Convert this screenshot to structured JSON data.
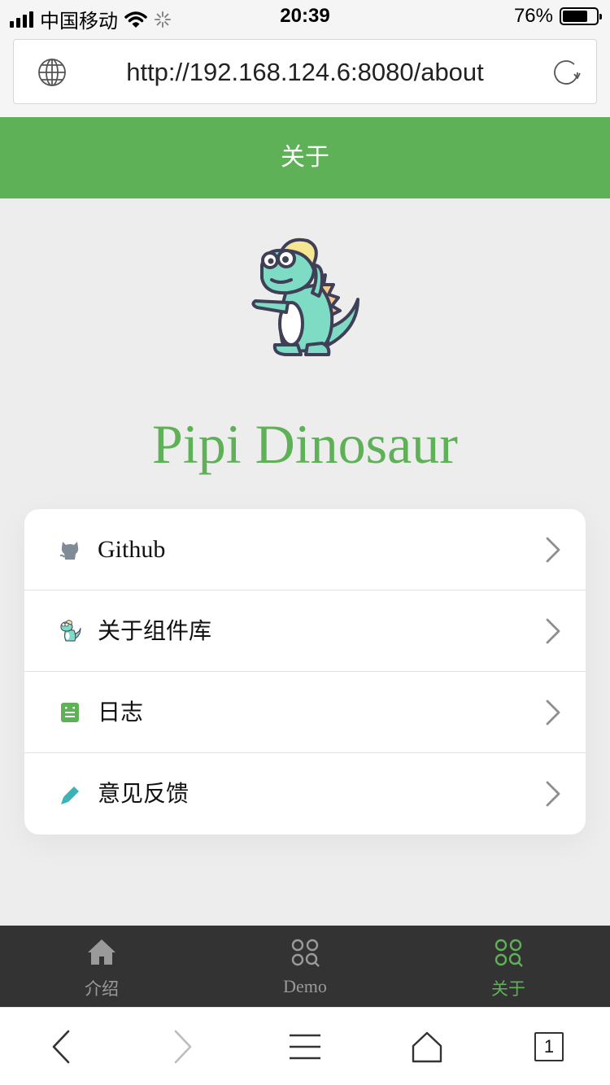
{
  "status_bar": {
    "carrier": "中国移动",
    "time": "20:39",
    "battery_percent_label": "76%",
    "battery_level": 0.76
  },
  "browser": {
    "url": "http://192.168.124.6:8080/about",
    "tab_count": "1"
  },
  "header": {
    "title": "关于"
  },
  "brand": {
    "title": "Pipi Dinosaur"
  },
  "menu": {
    "items": [
      {
        "label": "Github",
        "icon": "github-icon"
      },
      {
        "label": "关于组件库",
        "icon": "dinosaur-icon"
      },
      {
        "label": "日志",
        "icon": "log-icon"
      },
      {
        "label": "意见反馈",
        "icon": "pencil-icon"
      }
    ]
  },
  "tabs": [
    {
      "label": "介绍",
      "icon": "home-icon",
      "active": false
    },
    {
      "label": "Demo",
      "icon": "grid-search-icon",
      "active": false
    },
    {
      "label": "关于",
      "icon": "grid-search-icon",
      "active": true
    }
  ],
  "colors": {
    "accent": "#5fb157",
    "tab_bar": "#333333",
    "page_background": "#ededed",
    "mascot_body": "#7fdcc4",
    "mascot_crest": "#f5c98c"
  }
}
